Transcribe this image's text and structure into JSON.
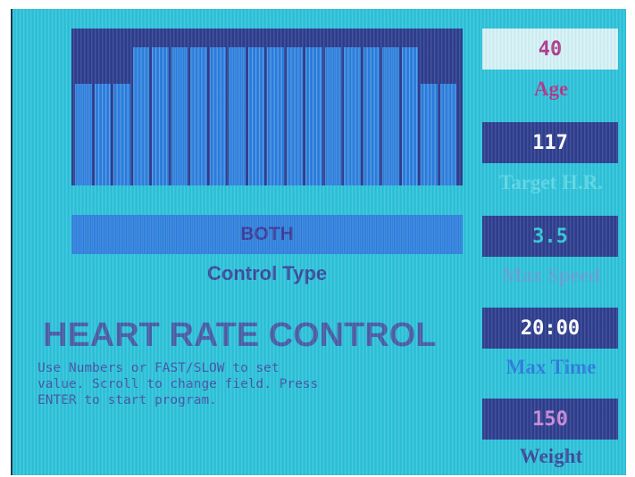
{
  "profile": {
    "levels": [
      0.65,
      0.65,
      0.65,
      0.88,
      0.88,
      0.88,
      0.88,
      0.88,
      0.88,
      0.88,
      0.88,
      0.88,
      0.88,
      0.88,
      0.88,
      0.88,
      0.88,
      0.88,
      0.65,
      0.65
    ],
    "colors": {
      "background": "#2f3f90",
      "bar": "#2a7fe0"
    }
  },
  "control_type": {
    "value": "BOTH",
    "label": "Control Type"
  },
  "mode_title": "HEART RATE CONTROL",
  "instructions": "Use Numbers or FAST/SLOW to set\nvalue. Scroll to change field. Press\nENTER to start program.",
  "fields": [
    {
      "id": "age",
      "value": "40",
      "label": "Age",
      "value_color": "#b03a8c",
      "label_color": "#b03a8c",
      "box": "light"
    },
    {
      "id": "target-hr",
      "value": "117",
      "label": "Target H.R.",
      "value_color": "#ffffff",
      "label_color": "#5fd8e8",
      "box": "dark"
    },
    {
      "id": "max-speed",
      "value": "3.5",
      "label": "Max Speed",
      "value_color": "#34c8d8",
      "label_color": "#5fa6d8",
      "box": "dark"
    },
    {
      "id": "max-time",
      "value": "20:00",
      "label": "Max Time",
      "value_color": "#ffffff",
      "label_color": "#2a7fe0",
      "box": "dark"
    },
    {
      "id": "weight",
      "value": "150",
      "label": "Weight",
      "value_color": "#c88ad8",
      "label_color": "#3d4a9c",
      "box": "dark"
    }
  ]
}
